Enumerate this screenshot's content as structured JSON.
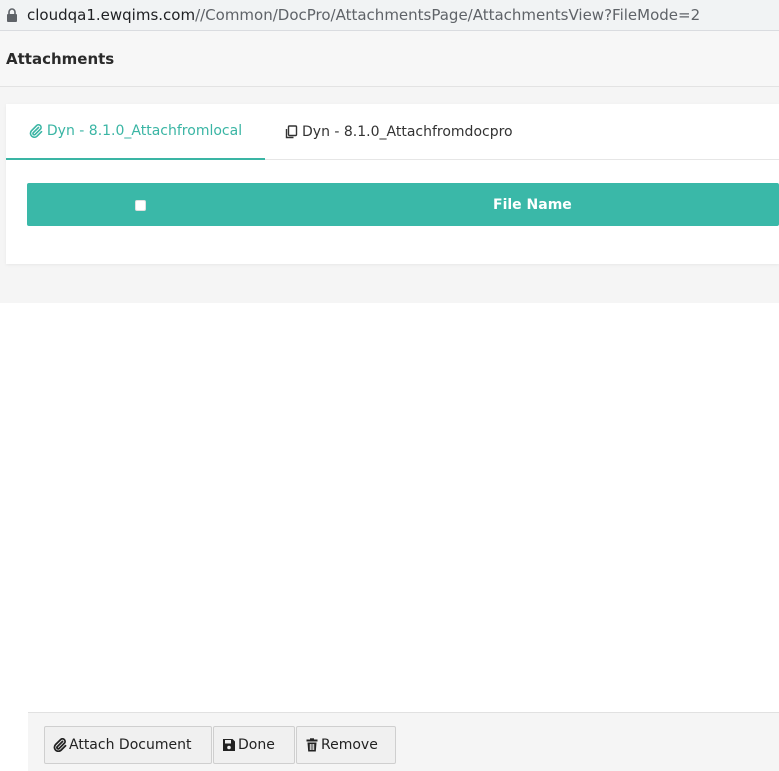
{
  "browser": {
    "url_host": "cloudqa1.ewqims.com",
    "url_path": "//Common/DocPro/AttachmentsPage/AttachmentsView?FileMode=2"
  },
  "page": {
    "title": "Attachments"
  },
  "tabs": [
    {
      "label": "Dyn - 8.1.0_Attachfromlocal",
      "icon": "paperclip-icon",
      "active": true
    },
    {
      "label": "Dyn - 8.1.0_Attachfromdocpro",
      "icon": "copy-icon",
      "active": false
    }
  ],
  "table": {
    "columns": [
      "File Name"
    ],
    "rows": []
  },
  "toolbar": {
    "attach_label": "Attach Document",
    "done_label": "Done",
    "remove_label": "Remove"
  },
  "colors": {
    "accent": "#3ab5a4",
    "header_bg": "#3ab8a8"
  }
}
